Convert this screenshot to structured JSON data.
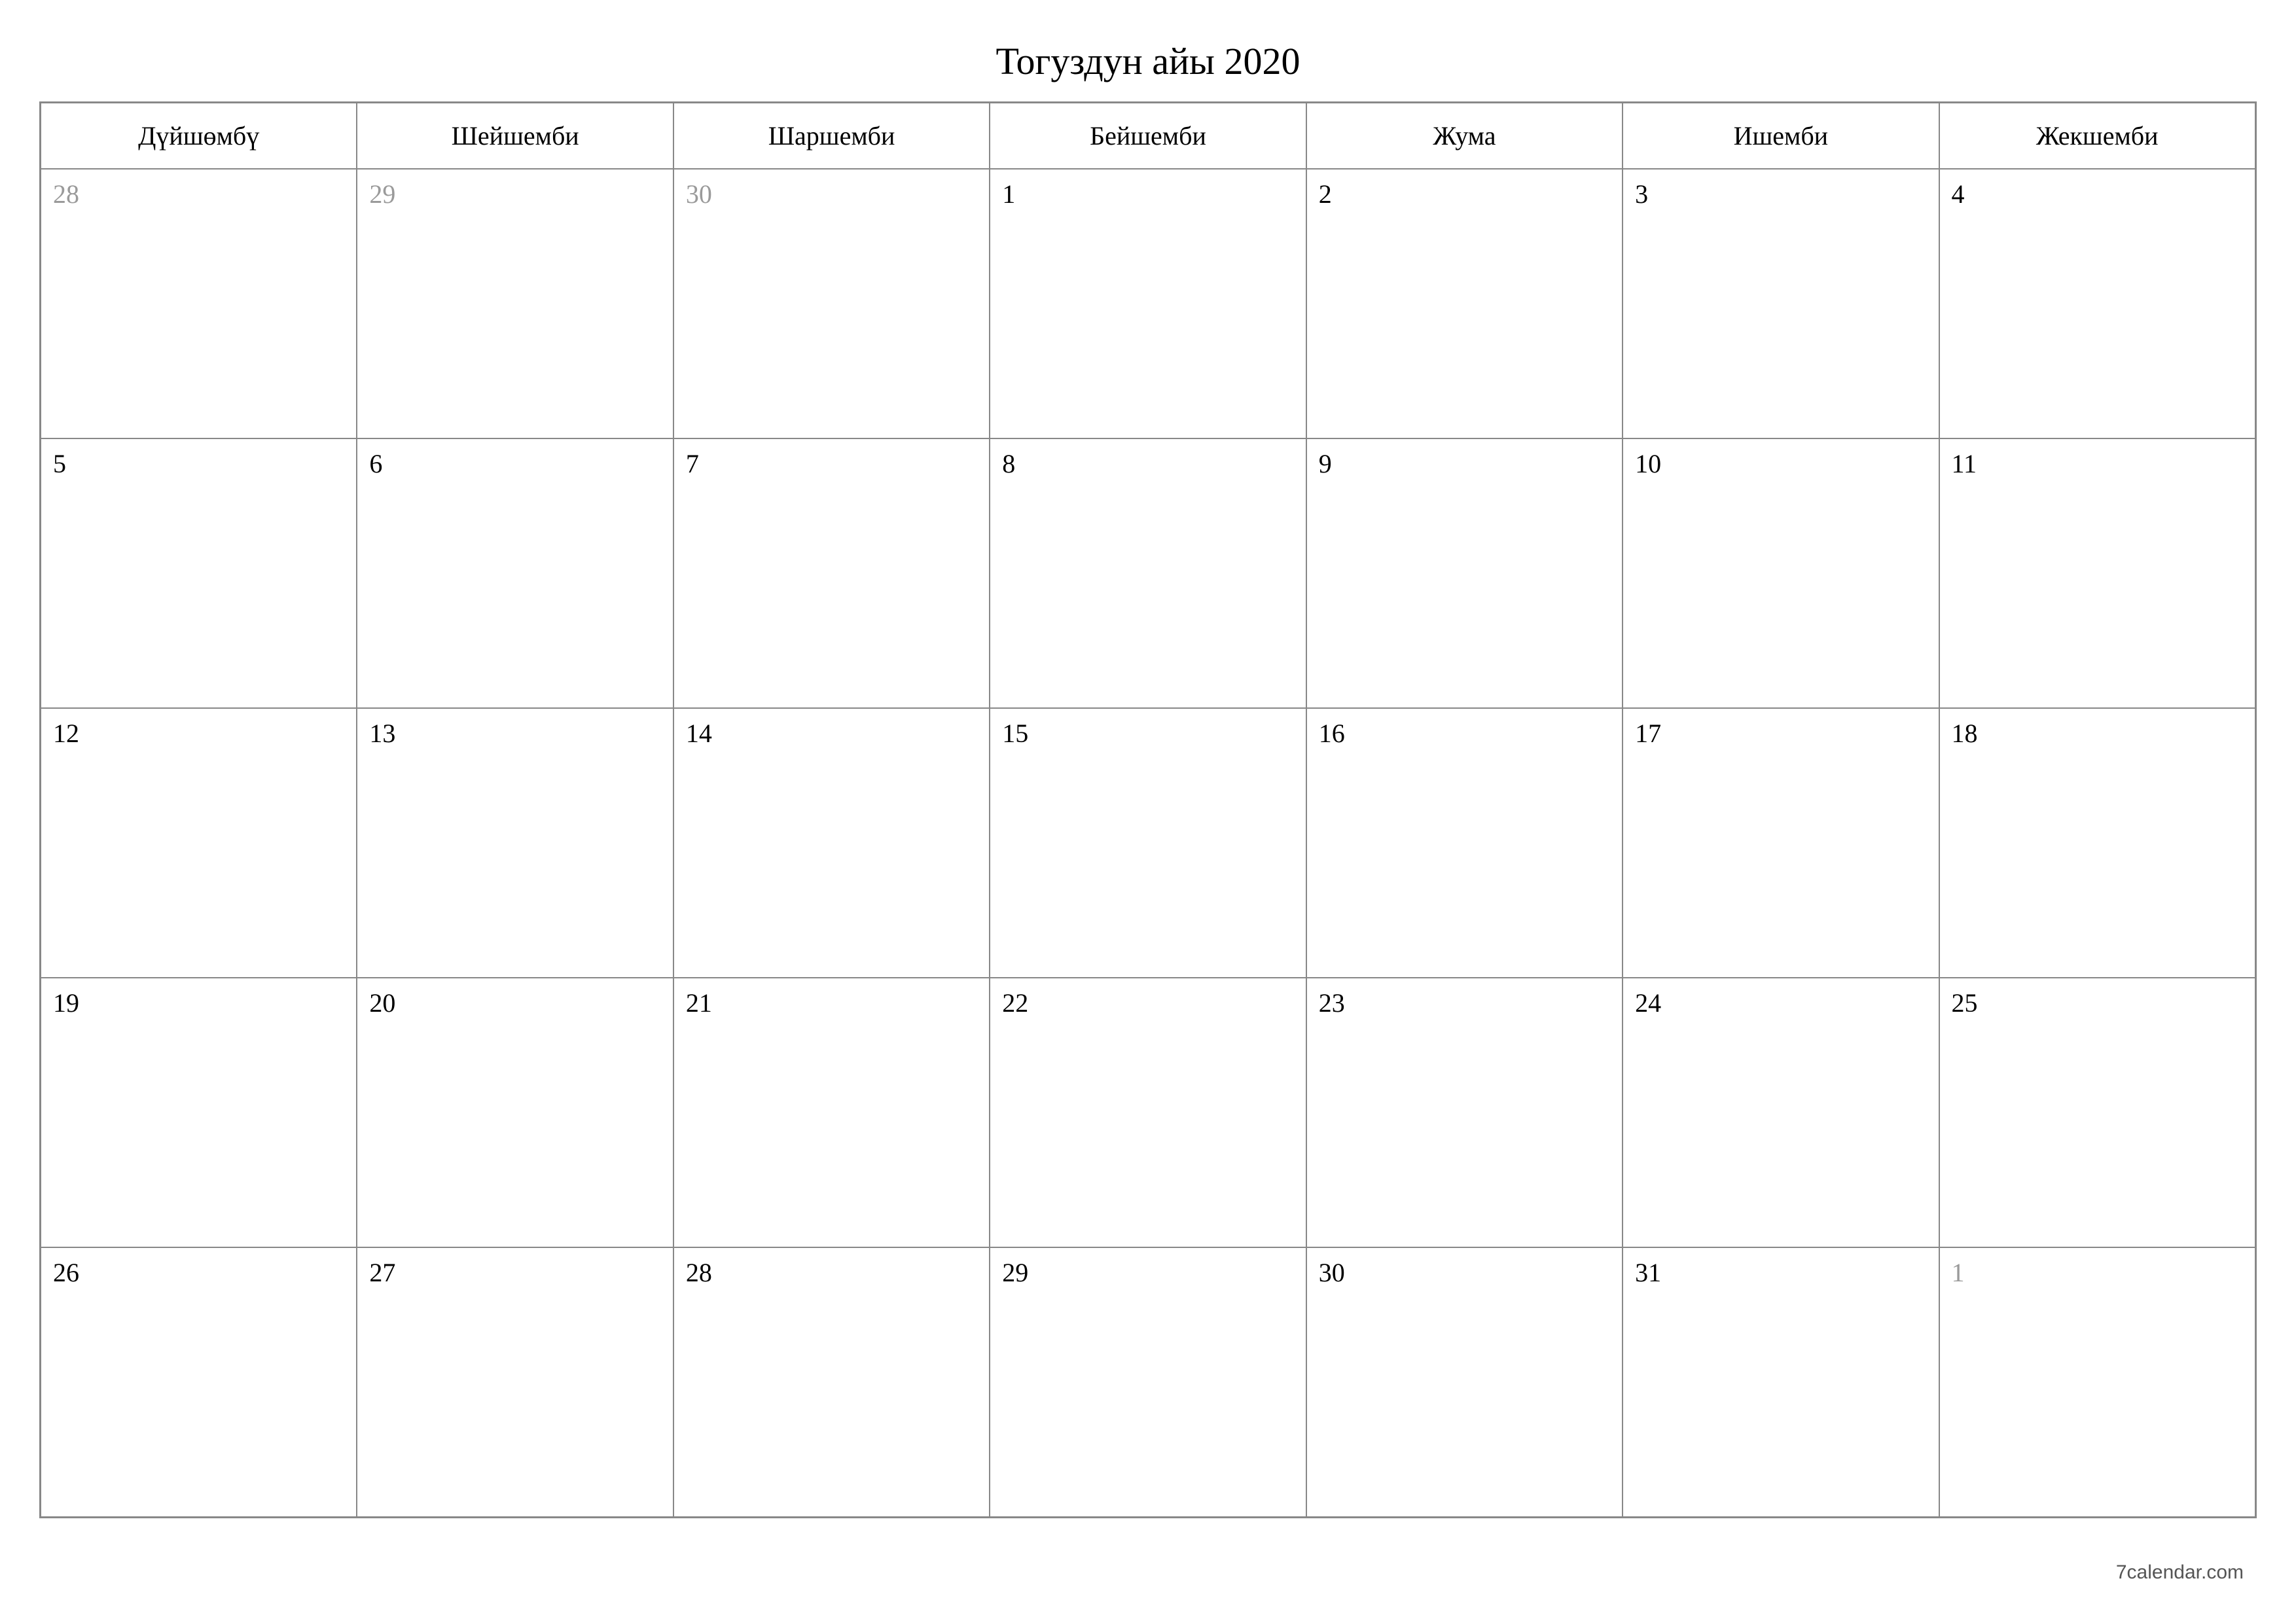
{
  "title": "Тогуздун айы 2020",
  "weekdays": [
    "Дүйшөмбү",
    "Шейшемби",
    "Шаршемби",
    "Бейшемби",
    "Жума",
    "Ишемби",
    "Жекшемби"
  ],
  "weeks": [
    [
      {
        "n": "28",
        "outside": true
      },
      {
        "n": "29",
        "outside": true
      },
      {
        "n": "30",
        "outside": true
      },
      {
        "n": "1",
        "outside": false
      },
      {
        "n": "2",
        "outside": false
      },
      {
        "n": "3",
        "outside": false
      },
      {
        "n": "4",
        "outside": false
      }
    ],
    [
      {
        "n": "5",
        "outside": false
      },
      {
        "n": "6",
        "outside": false
      },
      {
        "n": "7",
        "outside": false
      },
      {
        "n": "8",
        "outside": false
      },
      {
        "n": "9",
        "outside": false
      },
      {
        "n": "10",
        "outside": false
      },
      {
        "n": "11",
        "outside": false
      }
    ],
    [
      {
        "n": "12",
        "outside": false
      },
      {
        "n": "13",
        "outside": false
      },
      {
        "n": "14",
        "outside": false
      },
      {
        "n": "15",
        "outside": false
      },
      {
        "n": "16",
        "outside": false
      },
      {
        "n": "17",
        "outside": false
      },
      {
        "n": "18",
        "outside": false
      }
    ],
    [
      {
        "n": "19",
        "outside": false
      },
      {
        "n": "20",
        "outside": false
      },
      {
        "n": "21",
        "outside": false
      },
      {
        "n": "22",
        "outside": false
      },
      {
        "n": "23",
        "outside": false
      },
      {
        "n": "24",
        "outside": false
      },
      {
        "n": "25",
        "outside": false
      }
    ],
    [
      {
        "n": "26",
        "outside": false
      },
      {
        "n": "27",
        "outside": false
      },
      {
        "n": "28",
        "outside": false
      },
      {
        "n": "29",
        "outside": false
      },
      {
        "n": "30",
        "outside": false
      },
      {
        "n": "31",
        "outside": false
      },
      {
        "n": "1",
        "outside": true
      }
    ]
  ],
  "footer": "7calendar.com"
}
